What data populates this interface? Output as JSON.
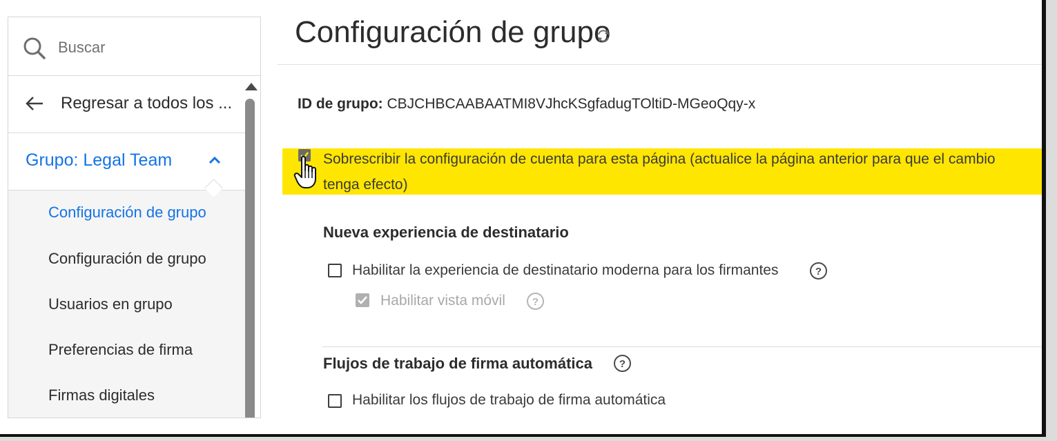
{
  "sidebar": {
    "search_placeholder": "Buscar",
    "back_label": "Regresar a todos los ...",
    "group_label": "Grupo: Legal Team",
    "items": [
      {
        "label": "Configuración de grupo",
        "active": true
      },
      {
        "label": "Configuración de grupo",
        "active": false
      },
      {
        "label": "Usuarios en grupo",
        "active": false
      },
      {
        "label": "Preferencias de firma",
        "active": false
      },
      {
        "label": "Firmas digitales",
        "active": false
      }
    ]
  },
  "main": {
    "title": "Configuración de grupo",
    "group_id_label": "ID de grupo:",
    "group_id_value": "CBJCHBCAABAATMI8VJhcKSgfadugTOltiD-MGeoQqy-x",
    "override_label": "Sobrescribir la configuración de cuenta para esta página (actualice la página anterior para que el cambio tenga efecto)",
    "sections": [
      {
        "heading": "Nueva experiencia de destinatario",
        "options": [
          {
            "label": "Habilitar la experiencia de destinatario moderna para los firmantes",
            "checked": false,
            "disabled": false
          },
          {
            "label": "Habilitar vista móvil",
            "checked": true,
            "disabled": true
          }
        ]
      },
      {
        "heading": "Flujos de trabajo de firma automática",
        "options": [
          {
            "label": "Habilitar los flujos de trabajo de firma automática",
            "checked": false,
            "disabled": false
          }
        ]
      }
    ]
  },
  "colors": {
    "accent": "#1473e6",
    "highlight": "#ffe600",
    "text": "#2c2c2c"
  }
}
